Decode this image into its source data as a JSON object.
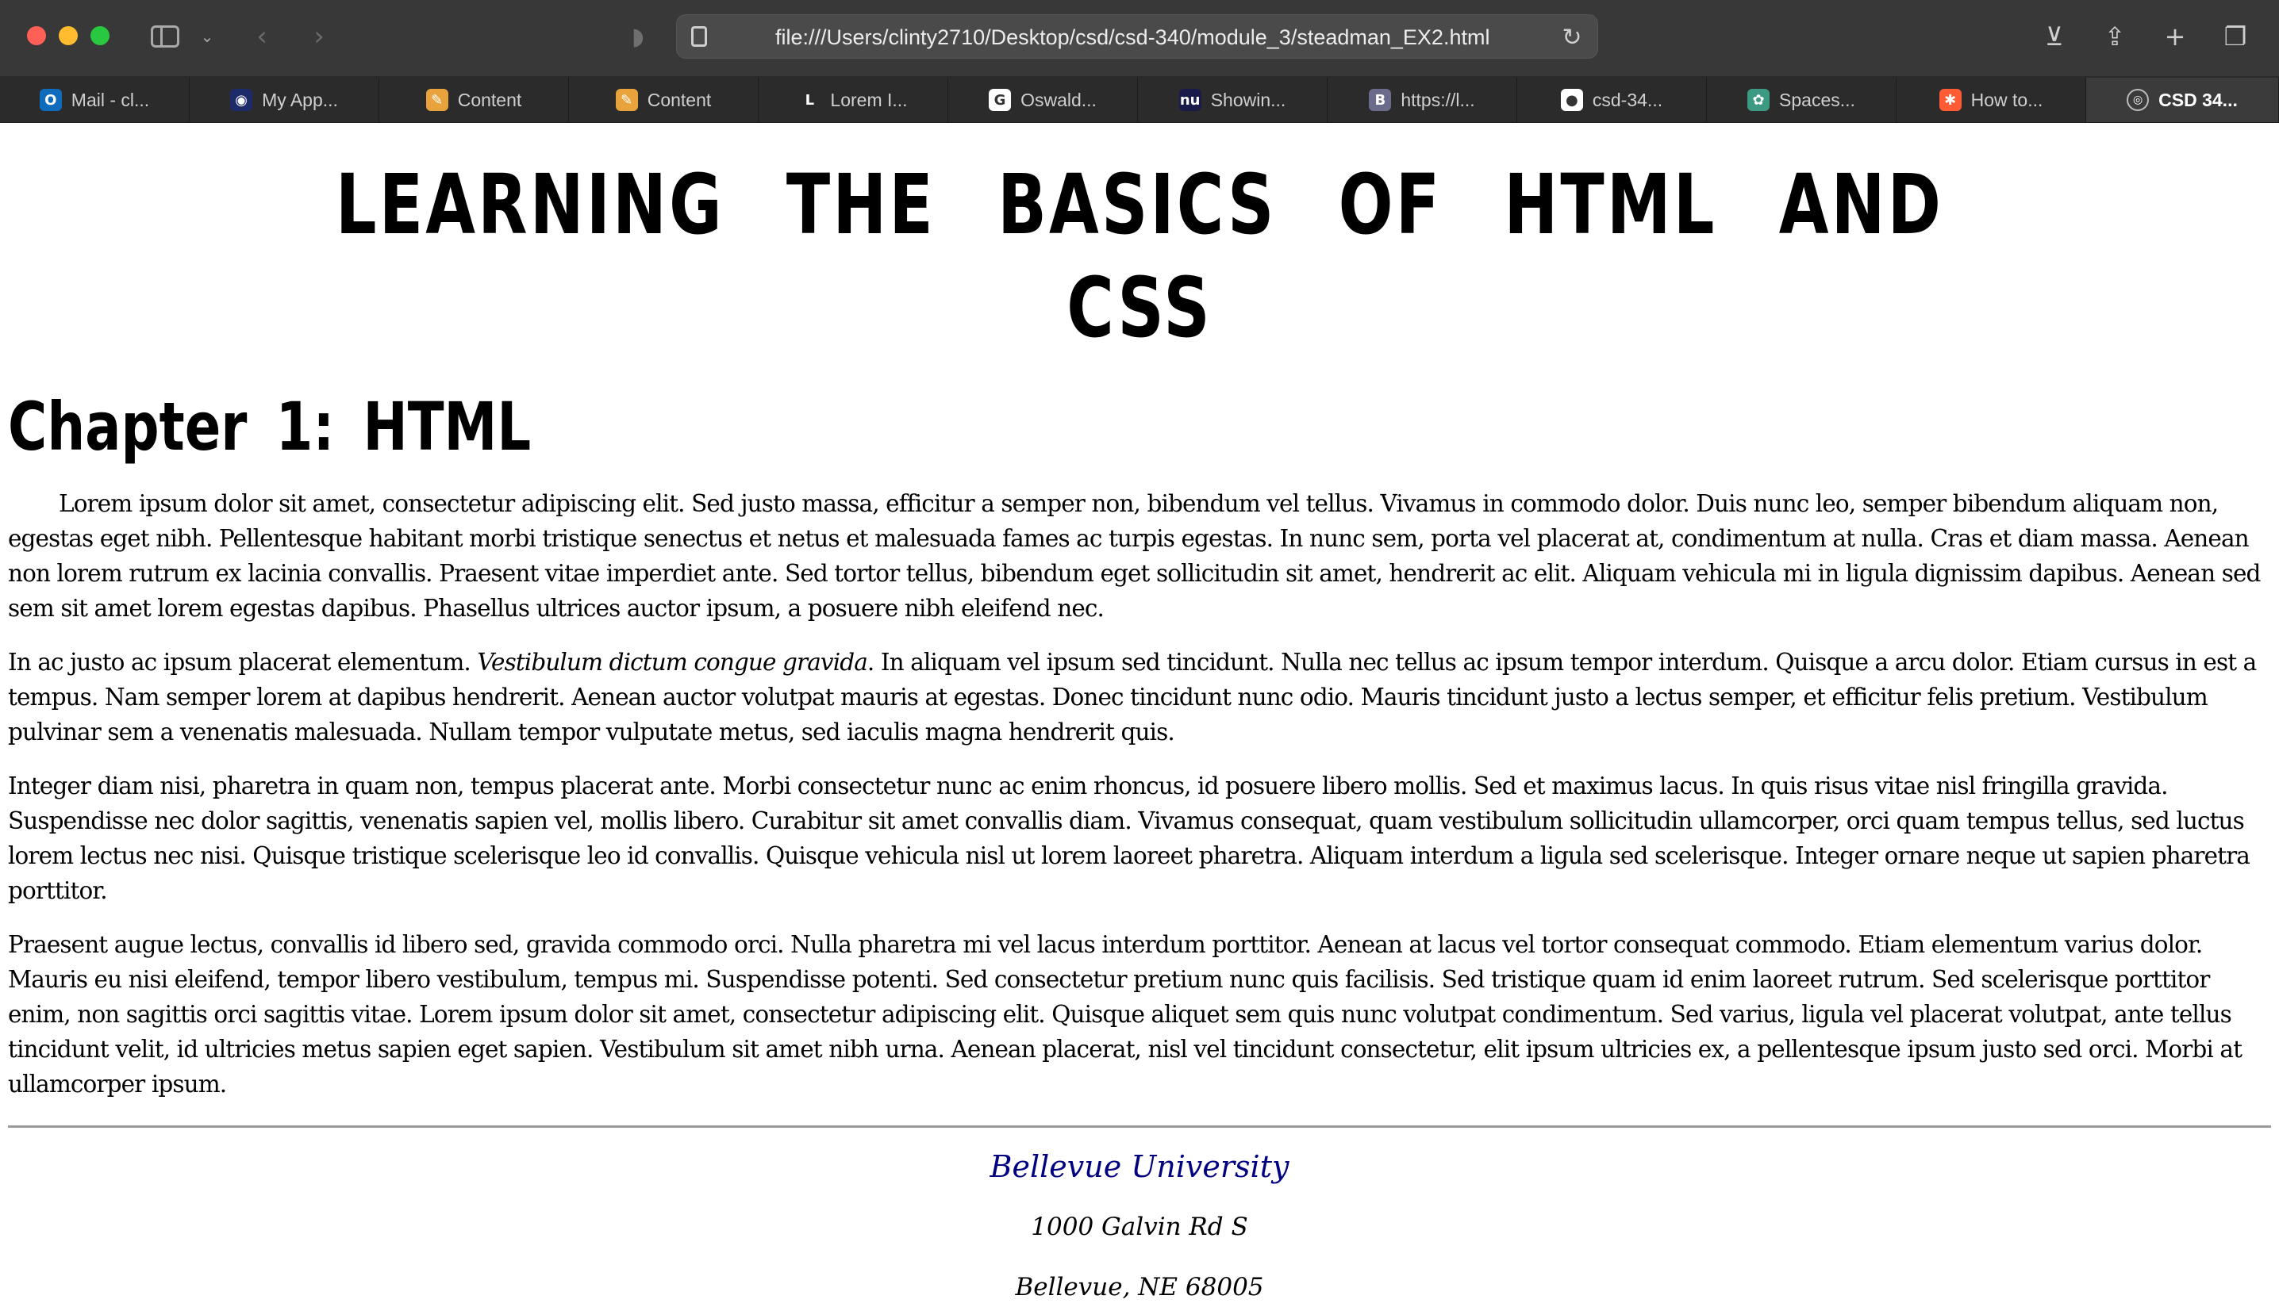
{
  "browser": {
    "url": "file:///Users/clinty2710/Desktop/csd/csd-340/module_3/steadman_EX2.html",
    "tabs": [
      {
        "label": "Mail - cl...",
        "icon": "outlook-icon",
        "color": "#0f6cbd"
      },
      {
        "label": "My App...",
        "icon": "circle-app-icon",
        "color": "#1d2b6b"
      },
      {
        "label": "Content",
        "icon": "pencil-note-icon",
        "color": "#e8a33c"
      },
      {
        "label": "Content",
        "icon": "pencil-note-icon",
        "color": "#e8a33c"
      },
      {
        "label": "Lorem I...",
        "icon": "lorem-l-icon",
        "color": "#2b2b2b"
      },
      {
        "label": "Oswald...",
        "icon": "google-icon",
        "color": "#ffffff"
      },
      {
        "label": "Showin...",
        "icon": "nu-icon",
        "color": "#1b1b4b"
      },
      {
        "label": "https://l...",
        "icon": "b-letter-icon",
        "color": "#6b6b8b"
      },
      {
        "label": "csd-34...",
        "icon": "github-icon",
        "color": "#ffffff"
      },
      {
        "label": "Spaces...",
        "icon": "openai-icon",
        "color": "#3c9a83"
      },
      {
        "label": "How to...",
        "icon": "hubspot-icon",
        "color": "#ff5c35"
      },
      {
        "label": "CSD 34...",
        "icon": "compass-icon",
        "color": "#3b3b3b",
        "active": true
      }
    ]
  },
  "page": {
    "title": "LEARNING THE BASICS OF HTML AND CSS",
    "chapter": "Chapter 1: HTML",
    "paragraphs": {
      "p1": "Lorem ipsum dolor sit amet, consectetur adipiscing elit. Sed justo massa, efficitur a semper non, bibendum vel tellus. Vivamus in commodo dolor. Duis nunc leo, semper bibendum aliquam non, egestas eget nibh. Pellentesque habitant morbi tristique senectus et netus et malesuada fames ac turpis egestas. In nunc sem, porta vel placerat at, condimentum at nulla. Cras et diam massa. Aenean non lorem rutrum ex lacinia convallis. Praesent vitae imperdiet ante. Sed tortor tellus, bibendum eget sollicitudin sit amet, hendrerit ac elit. Aliquam vehicula mi in ligula dignissim dapibus. Aenean sed sem sit amet lorem egestas dapibus. Phasellus ultrices auctor ipsum, a posuere nibh eleifend nec.",
      "p2_start": "In ac justo ac ipsum placerat elementum. ",
      "p2_italic": "Vestibulum dictum congue gravida",
      "p2_end": ". In aliquam vel ipsum sed tincidunt. Nulla nec tellus ac ipsum tempor interdum. Quisque a arcu dolor. Etiam cursus in est a tempus. Nam semper lorem at dapibus hendrerit. Aenean auctor volutpat mauris at egestas. Donec tincidunt nunc odio. Mauris tincidunt justo a lectus semper, et efficitur felis pretium. Vestibulum pulvinar sem a venenatis malesuada. Nullam tempor vulputate metus, sed iaculis magna hendrerit quis.",
      "p3": "Integer diam nisi, pharetra in quam non, tempus placerat ante. Morbi consectetur nunc ac enim rhoncus, id posuere libero mollis. Sed et maximus lacus. In quis risus vitae nisl fringilla gravida. Suspendisse nec dolor sagittis, venenatis sapien vel, mollis libero. Curabitur sit amet convallis diam. Vivamus consequat, quam vestibulum sollicitudin ullamcorper, orci quam tempus tellus, sed luctus lorem lectus nec nisi. Quisque tristique scelerisque leo id convallis. Quisque vehicula nisl ut lorem laoreet pharetra. Aliquam interdum a ligula sed scelerisque. Integer ornare neque ut sapien pharetra porttitor.",
      "p4": "Praesent augue lectus, convallis id libero sed, gravida commodo orci. Nulla pharetra mi vel lacus interdum porttitor. Aenean at lacus vel tortor consequat commodo. Etiam elementum varius dolor. Mauris eu nisi eleifend, tempor libero vestibulum, tempus mi. Suspendisse potenti. Sed consectetur pretium nunc quis facilisis. Sed tristique quam id enim laoreet rutrum. Sed scelerisque porttitor enim, non sagittis orci sagittis vitae. Lorem ipsum dolor sit amet, consectetur adipiscing elit. Quisque aliquet sem quis nunc volutpat condimentum. Sed varius, ligula vel placerat volutpat, ante tellus tincidunt velit, id ultricies metus sapien eget sapien. Vestibulum sit amet nibh urna. Aenean placerat, nisl vel tincidunt consectetur, elit ipsum ultricies ex, a pellentesque ipsum justo sed orci. Morbi at ullamcorper ipsum."
    },
    "footer": {
      "university": "Bellevue University",
      "street": "1000 Galvin Rd S",
      "city": "Bellevue, NE 68005"
    }
  },
  "colors": {
    "footer_link": "#000080"
  }
}
